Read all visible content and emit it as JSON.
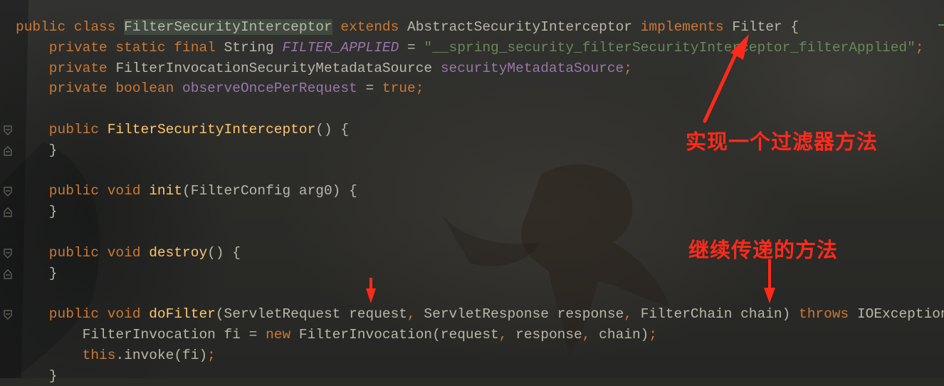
{
  "editor": {
    "lines": [
      [
        {
          "t": "public class ",
          "c": "kw"
        },
        {
          "t": "FilterSecurityInterceptor",
          "c": "cls-hl"
        },
        {
          "t": " ",
          "c": ""
        },
        {
          "t": "extends ",
          "c": "kw"
        },
        {
          "t": "AbstractSecurityInterceptor ",
          "c": "type"
        },
        {
          "t": "implements ",
          "c": "kw"
        },
        {
          "t": "Filter {",
          "c": "type"
        }
      ],
      [
        {
          "t": "    private static final ",
          "c": "kw"
        },
        {
          "t": "String ",
          "c": "type"
        },
        {
          "t": "FILTER_APPLIED",
          "c": "field italic"
        },
        {
          "t": " = ",
          "c": "type"
        },
        {
          "t": "\"__spring_security_filterSecurityInterceptor_filterApplied\"",
          "c": "str"
        },
        {
          "t": ";",
          "c": "kw"
        }
      ],
      [
        {
          "t": "    private ",
          "c": "kw"
        },
        {
          "t": "FilterInvocationSecurityMetadataSource ",
          "c": "type"
        },
        {
          "t": "securityMetadataSource",
          "c": "field"
        },
        {
          "t": ";",
          "c": "kw"
        }
      ],
      [
        {
          "t": "    private boolean ",
          "c": "kw"
        },
        {
          "t": "observeOncePerRequest",
          "c": "field"
        },
        {
          "t": " = ",
          "c": "type"
        },
        {
          "t": "true",
          "c": "kw"
        },
        {
          "t": ";",
          "c": "kw"
        }
      ],
      [
        {
          "t": "",
          "c": ""
        }
      ],
      [
        {
          "t": "    public ",
          "c": "kw"
        },
        {
          "t": "FilterSecurityInterceptor",
          "c": "fn"
        },
        {
          "t": "() {",
          "c": "type"
        }
      ],
      [
        {
          "t": "    }",
          "c": "type"
        }
      ],
      [
        {
          "t": "",
          "c": ""
        }
      ],
      [
        {
          "t": "    public void ",
          "c": "kw"
        },
        {
          "t": "init",
          "c": "fn"
        },
        {
          "t": "(FilterConfig arg0) {",
          "c": "type"
        }
      ],
      [
        {
          "t": "    }",
          "c": "type"
        }
      ],
      [
        {
          "t": "",
          "c": ""
        }
      ],
      [
        {
          "t": "    public void ",
          "c": "kw"
        },
        {
          "t": "destroy",
          "c": "fn"
        },
        {
          "t": "() {",
          "c": "type"
        }
      ],
      [
        {
          "t": "    }",
          "c": "type"
        }
      ],
      [
        {
          "t": "",
          "c": ""
        }
      ],
      [
        {
          "t": "    public void ",
          "c": "kw"
        },
        {
          "t": "doFilter",
          "c": "fn"
        },
        {
          "t": "(ServletRequest request",
          "c": "type"
        },
        {
          "t": ", ",
          "c": "kw"
        },
        {
          "t": "ServletResponse response",
          "c": "type"
        },
        {
          "t": ", ",
          "c": "kw"
        },
        {
          "t": "FilterChain chain) ",
          "c": "type"
        },
        {
          "t": "throws ",
          "c": "kw"
        },
        {
          "t": "IOException",
          "c": "type"
        }
      ],
      [
        {
          "t": "        FilterInvocation fi = ",
          "c": "type"
        },
        {
          "t": "new ",
          "c": "kw"
        },
        {
          "t": "FilterInvocation(request",
          "c": "type"
        },
        {
          "t": ", ",
          "c": "kw"
        },
        {
          "t": "response",
          "c": "type"
        },
        {
          "t": ", ",
          "c": "kw"
        },
        {
          "t": "chain)",
          "c": "type"
        },
        {
          "t": ";",
          "c": "kw"
        }
      ],
      [
        {
          "t": "        ",
          "c": ""
        },
        {
          "t": "this",
          "c": "kw"
        },
        {
          "t": ".invoke(fi)",
          "c": "type"
        },
        {
          "t": ";",
          "c": "kw"
        }
      ],
      [
        {
          "t": "    }",
          "c": "type"
        }
      ]
    ],
    "fold_markers": [
      {
        "line": 5,
        "kind": "open"
      },
      {
        "line": 6,
        "kind": "close"
      },
      {
        "line": 8,
        "kind": "open"
      },
      {
        "line": 9,
        "kind": "close"
      },
      {
        "line": 11,
        "kind": "open"
      },
      {
        "line": 12,
        "kind": "close"
      },
      {
        "line": 14,
        "kind": "open"
      }
    ]
  },
  "annotations": {
    "filter_note": "实现一个过滤器方法",
    "chain_note": "继续传递的方法",
    "color": "#ff2a1a"
  },
  "colors": {
    "keyword": "#cc7832",
    "plain": "#b9b7aa",
    "method": "#ffc66d",
    "field": "#9876aa",
    "string": "#6a8759"
  }
}
